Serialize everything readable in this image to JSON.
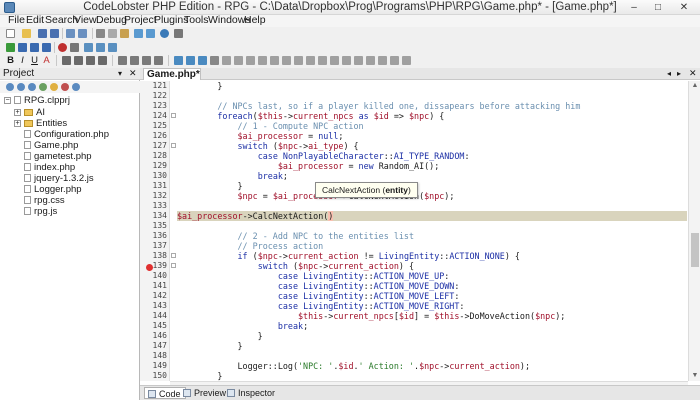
{
  "window": {
    "title": "CodeLobster PHP Edition - RPG - C:\\Data\\Dropbox\\Prog\\Programs\\PHP\\RPG\\Game.php* - [Game.php*]",
    "controls": [
      "–",
      "□",
      "✕"
    ]
  },
  "menu": [
    "File",
    "Edit",
    "Search",
    "View",
    "Debug",
    "Project",
    "Plugins",
    "Tools",
    "Windows",
    "Help"
  ],
  "format_toolbar": [
    "B",
    "I",
    "U",
    "A"
  ],
  "project_panel": {
    "title": "Project",
    "pin": "▾",
    "close": "✕",
    "root": "RPG.clpprj",
    "items": [
      "AI",
      "Entities",
      "Configuration.php",
      "Game.php",
      "gametest.php",
      "index.php",
      "jquery-1.3.2.js",
      "Logger.php",
      "rpg.css",
      "rpg.js"
    ]
  },
  "editor": {
    "tab_label": "Game.php*",
    "tab_nav_left": "◂",
    "tab_nav_right": "▸",
    "tab_close": "✕",
    "line_numbers": [
      "121",
      "122",
      "123",
      "124",
      "125",
      "126",
      "127",
      "128",
      "129",
      "130",
      "131",
      "132",
      "133",
      "134",
      "135",
      "136",
      "137",
      "138",
      "139",
      "140",
      "141",
      "142",
      "143",
      "144",
      "145",
      "146",
      "147",
      "148",
      "149",
      "150"
    ],
    "tooltip": {
      "prefix": "CalcNextAction (",
      "param": "entity",
      "suffix": ")"
    },
    "bottom_tabs": [
      "Code",
      "Preview",
      "Inspector"
    ]
  },
  "colors": {
    "current_line": "#d9d4bd",
    "comment": "#6a8faf",
    "keyword": "#1c2fa5",
    "variable": "#a0102a",
    "string": "#2a7a2a",
    "breakpoint": "#e03030"
  }
}
